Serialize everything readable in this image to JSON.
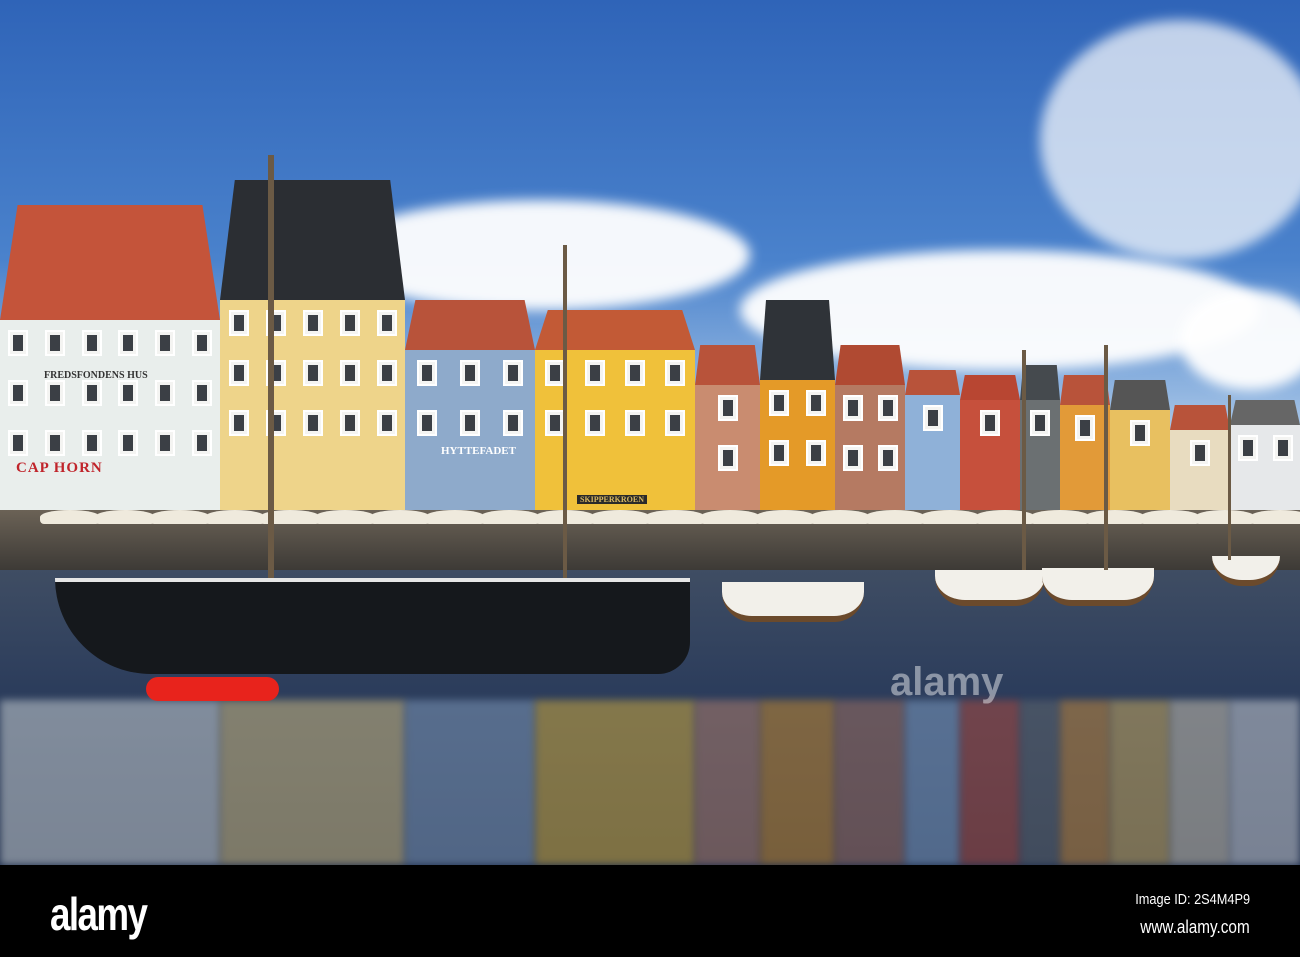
{
  "photo": {
    "subject": "Nyhavn harbour",
    "signs": {
      "fredsfondens": "FREDSFONDENS HUS",
      "cap_horn": "CAP HORN",
      "hyttefadet": "HYTTEFADET",
      "skipperkroen": "SKIPPERKROEN"
    },
    "colors": {
      "sky": "#3a6fc0",
      "water": "#2c3d5c",
      "hull": "#15181c",
      "dinghy": "#e8231c"
    }
  },
  "watermark": {
    "text": "alamy"
  },
  "footer": {
    "logo": "alamy",
    "image_id": "Image ID: 2S4M4P9",
    "website": "www.alamy.com"
  }
}
